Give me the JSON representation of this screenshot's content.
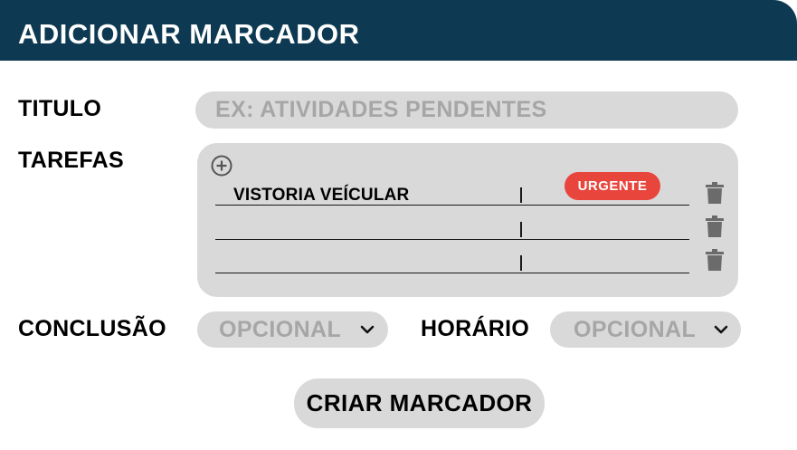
{
  "header": {
    "title": "ADICIONAR MARCADOR"
  },
  "form": {
    "title_label": "TITULO",
    "title_placeholder": "EX: ATIVIDADES PENDENTES",
    "tasks_label": "TAREFAS",
    "conclusion_label": "CONCLUSÃO",
    "time_label": "HORÁRIO"
  },
  "tasks": [
    {
      "name": "VISTORIA VEÍCULAR",
      "badge": "URGENTE"
    },
    {
      "name": "",
      "badge": ""
    },
    {
      "name": "",
      "badge": ""
    }
  ],
  "conclusion_select": {
    "value": "OPCIONAL"
  },
  "time_select": {
    "value": "OPCIONAL"
  },
  "create_button": {
    "label": "CRIAR MARCADOR"
  },
  "colors": {
    "header": "#0d3a52",
    "field_bg": "#d9d9d9",
    "placeholder": "#a6a6a6",
    "urgent_badge": "#e8453c"
  },
  "icons": {
    "add": "plus-circle-icon",
    "delete": "trash-icon",
    "dropdown": "chevron-down-icon"
  }
}
